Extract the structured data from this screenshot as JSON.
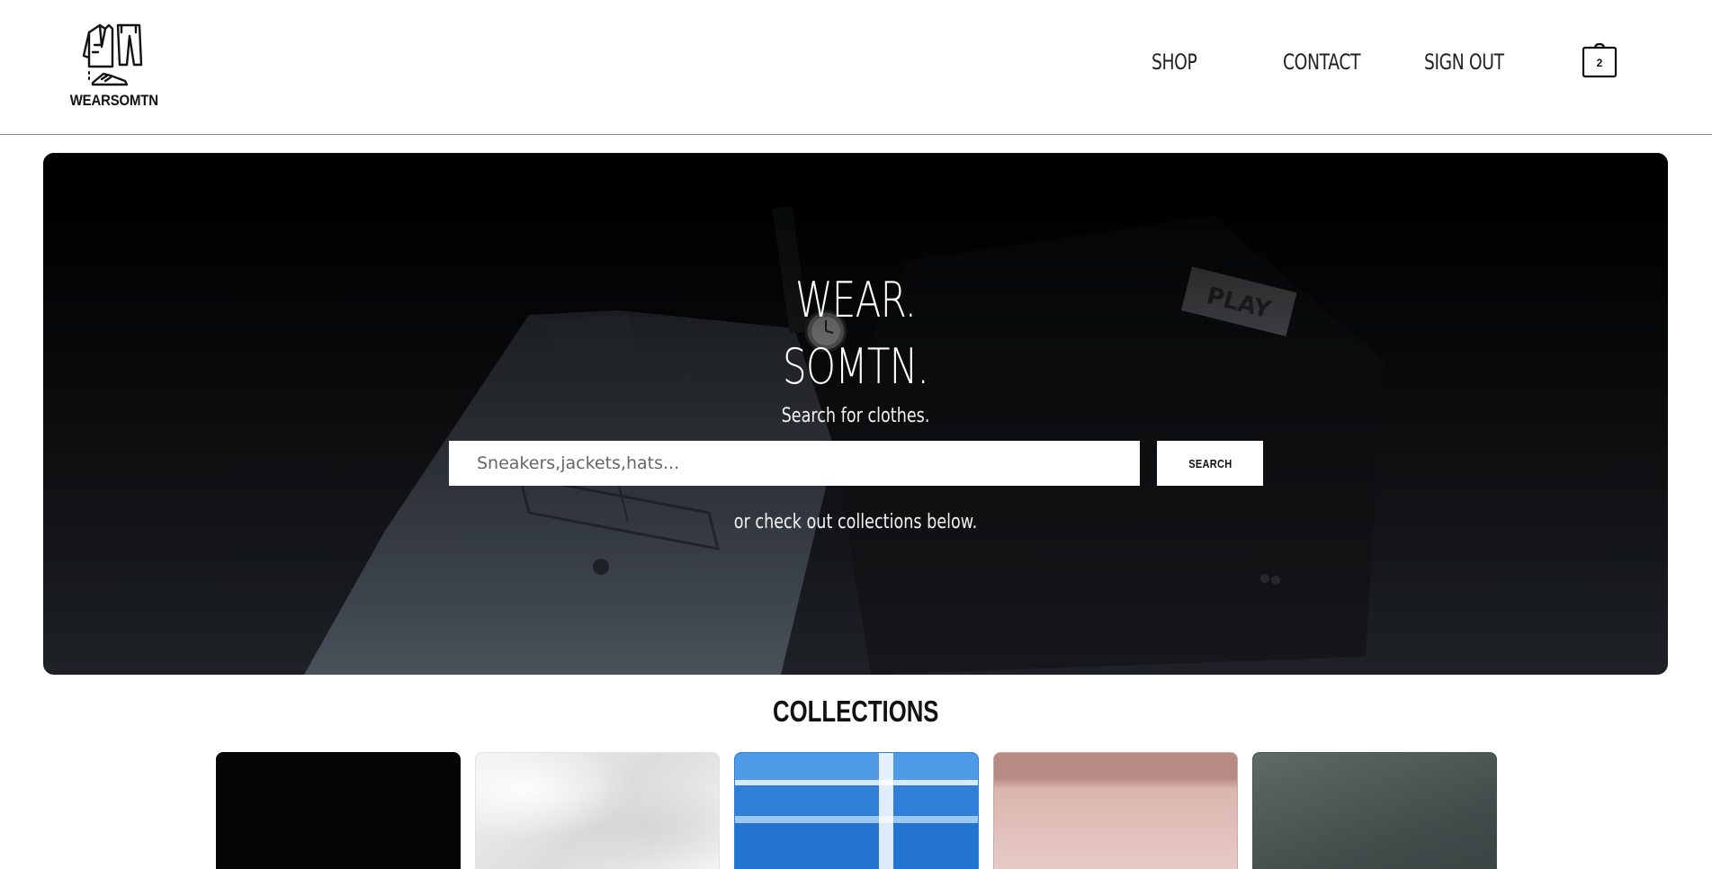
{
  "header": {
    "brand": "WEARSOMTN",
    "nav": {
      "shop": "SHOP",
      "contact": "CONTACT",
      "sign_out": "SIGN OUT"
    },
    "cart_count": "2",
    "icons": {
      "logo": "clothing-logo-icon",
      "cart": "shopping-bag-icon"
    }
  },
  "hero": {
    "title_line1": "WEAR.",
    "title_line2": "SOMTN.",
    "subtitle": "Search for clothes.",
    "search": {
      "placeholder": "Sneakers,jackets,hats...",
      "value": "",
      "button_label": "SEARCH"
    },
    "secondary": "or check out collections below."
  },
  "collections": {
    "title": "COLLECTIONS",
    "cards": [
      {
        "color": "#050505"
      },
      {
        "color": "#ececec"
      },
      {
        "color": "#2f7fd8"
      },
      {
        "color": "#d9b6b0"
      },
      {
        "color": "#4a5453"
      }
    ]
  }
}
